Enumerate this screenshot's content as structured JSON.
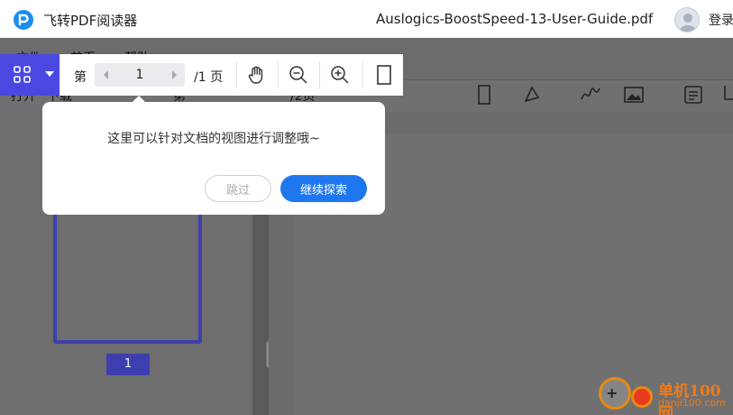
{
  "app": {
    "name": "飞转PDF阅读器",
    "document_title": "Auslogics-BoostSpeed-13-User-Guide.pdf",
    "login_label": "登录",
    "accent": "#4a48e0"
  },
  "menu": {
    "items": [
      "文件",
      "首页",
      "帮助"
    ]
  },
  "toolbar": {
    "open_label": "打开",
    "download_label": "下载",
    "page_prefix": "第",
    "page_total": "/2页"
  },
  "view_toolbar": {
    "page_prefix": "第",
    "current_page": "1",
    "page_total": "/1 页",
    "icons": [
      "grid-icon",
      "hand-icon",
      "zoom-out-icon",
      "zoom-in-icon",
      "single-page-icon"
    ]
  },
  "tooltip": {
    "message": "这里可以针对文档的视图进行调整哦~",
    "skip_label": "跳过",
    "continue_label": "继续探索"
  },
  "sidebar": {
    "page_badge": "1"
  },
  "watermark": {
    "line1": "单机100网",
    "line2": "danji100.com"
  }
}
